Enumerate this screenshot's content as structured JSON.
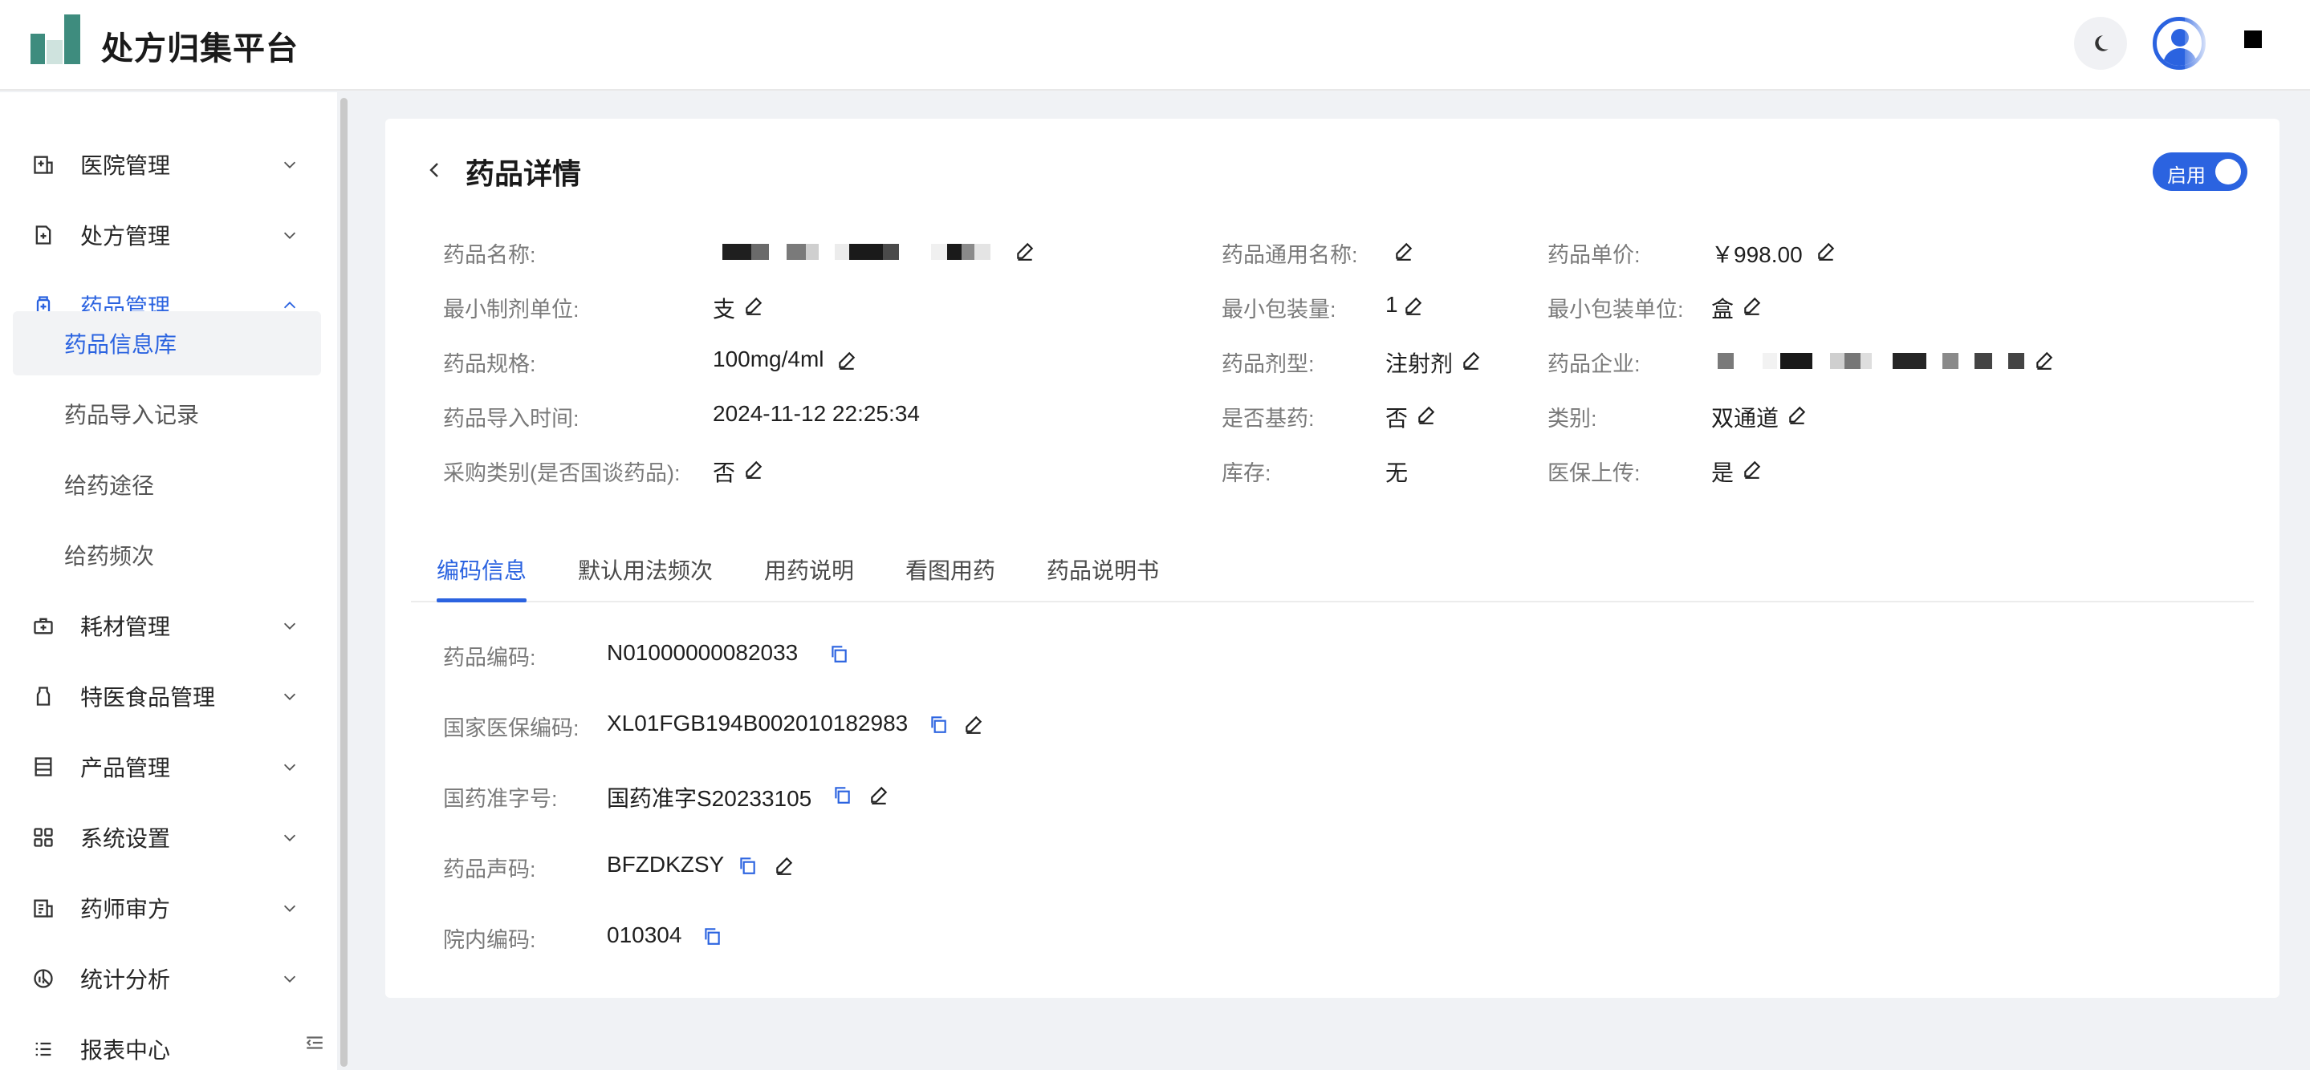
{
  "app": {
    "title": "处方归集平台"
  },
  "header": {
    "theme_icon": "moon-icon",
    "avatar_icon": "user-avatar-icon"
  },
  "sidebar": {
    "items": [
      {
        "label": "医院管理",
        "icon": "hospital-icon",
        "expanded": false
      },
      {
        "label": "处方管理",
        "icon": "prescription-icon",
        "expanded": false
      },
      {
        "label": "药品管理",
        "icon": "medicine-icon",
        "expanded": true,
        "active": true,
        "children": [
          {
            "label": "药品信息库",
            "active": true
          },
          {
            "label": "药品导入记录"
          },
          {
            "label": "给药途径"
          },
          {
            "label": "给药频次"
          }
        ]
      },
      {
        "label": "耗材管理",
        "icon": "supplies-icon",
        "expanded": false
      },
      {
        "label": "特医食品管理",
        "icon": "food-icon",
        "expanded": false
      },
      {
        "label": "产品管理",
        "icon": "product-icon",
        "expanded": false
      },
      {
        "label": "系统设置",
        "icon": "grid-icon",
        "expanded": false
      },
      {
        "label": "药师审方",
        "icon": "review-icon",
        "expanded": false
      },
      {
        "label": "统计分析",
        "icon": "chart-icon",
        "expanded": false
      },
      {
        "label": "报表中心",
        "icon": "list-icon",
        "expanded": false
      }
    ]
  },
  "detail": {
    "title": "药品详情",
    "status_switch": {
      "label": "启用",
      "on": true
    },
    "fields": {
      "drug_name": {
        "label": "药品名称:",
        "value": ""
      },
      "generic_name": {
        "label": "药品通用名称:",
        "value": ""
      },
      "unit_price": {
        "label": "药品单价:",
        "value": "￥998.00"
      },
      "min_dose_unit": {
        "label": "最小制剂单位:",
        "value": "支"
      },
      "min_package_qty": {
        "label": "最小包装量:",
        "value": "1"
      },
      "min_package_unit": {
        "label": "最小包装单位:",
        "value": "盒"
      },
      "spec": {
        "label": "药品规格:",
        "value": "100mg/4ml"
      },
      "dosage_form": {
        "label": "药品剂型:",
        "value": "注射剂"
      },
      "manufacturer": {
        "label": "药品企业:",
        "value": ""
      },
      "import_time": {
        "label": "药品导入时间:",
        "value": "2024-11-12 22:25:34"
      },
      "is_essential": {
        "label": "是否基药:",
        "value": "否"
      },
      "category": {
        "label": "类别:",
        "value": "双通道"
      },
      "purchase_type": {
        "label": "采购类别(是否国谈药品):",
        "value": "否"
      },
      "stock": {
        "label": "库存:",
        "value": "无"
      },
      "insurance_upload": {
        "label": "医保上传:",
        "value": "是"
      }
    },
    "tabs": [
      {
        "label": "编码信息",
        "active": true
      },
      {
        "label": "默认用法频次"
      },
      {
        "label": "用药说明"
      },
      {
        "label": "看图用药"
      },
      {
        "label": "药品说明书"
      }
    ],
    "codes": {
      "drug_code": {
        "label": "药品编码:",
        "value": "N01000000082033"
      },
      "national_insurance_code": {
        "label": "国家医保编码:",
        "value": "XL01FGB194B002010182983"
      },
      "approval_number": {
        "label": "国药准字号:",
        "value": "国药准字S20233105"
      },
      "drug_sound_code": {
        "label": "药品声码:",
        "value": "BFZDKZSY"
      },
      "hospital_code": {
        "label": "院内编码:",
        "value": "010304"
      }
    }
  },
  "colors": {
    "primary": "#2b63e0",
    "logo": "#3e8c7e"
  }
}
